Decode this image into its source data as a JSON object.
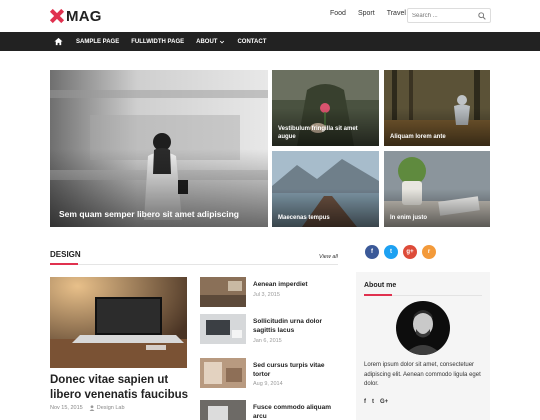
{
  "brand": {
    "logo_text": "MAG",
    "accent": "#e0314f"
  },
  "top_links": [
    "Food",
    "Sport",
    "Travel"
  ],
  "search": {
    "placeholder": "Search ..."
  },
  "nav": {
    "items": [
      "SAMPLE PAGE",
      "FULLWIDTH PAGE",
      "ABOUT",
      "CONTACT"
    ]
  },
  "mosaic": {
    "big": "Sem quam semper libero sit amet adipiscing",
    "t1": "Vestibulum fringilla sit amet augue",
    "t2": "Aliquam lorem ante",
    "t3": "Maecenas tempus",
    "t4": "In enim justo"
  },
  "design": {
    "title": "DESIGN",
    "view_all": "View all",
    "featured": {
      "title": "Donec vitae sapien ut libero venenatis faucibus",
      "date": "Nov 15, 2015",
      "author": "Design Lab"
    },
    "list": [
      {
        "title": "Aenean imperdiet",
        "date": "Jul 3, 2015"
      },
      {
        "title": "Sollicitudin urna dolor sagittis lacus",
        "date": "Jan 6, 2015"
      },
      {
        "title": "Sed cursus turpis vitae tortor",
        "date": "Aug 9, 2014"
      },
      {
        "title": "Fusce commodo aliquam arcu",
        "date": ""
      }
    ]
  },
  "social": {
    "facebook": "f",
    "twitter": "t",
    "google": "g+",
    "rss": "r"
  },
  "about": {
    "title": "About me",
    "text": "Lorem ipsum dolor sit amet, consectetuer adipiscing elit. Aenean commodo ligula eget dolor.",
    "links": [
      "f",
      "t",
      "G+"
    ]
  }
}
